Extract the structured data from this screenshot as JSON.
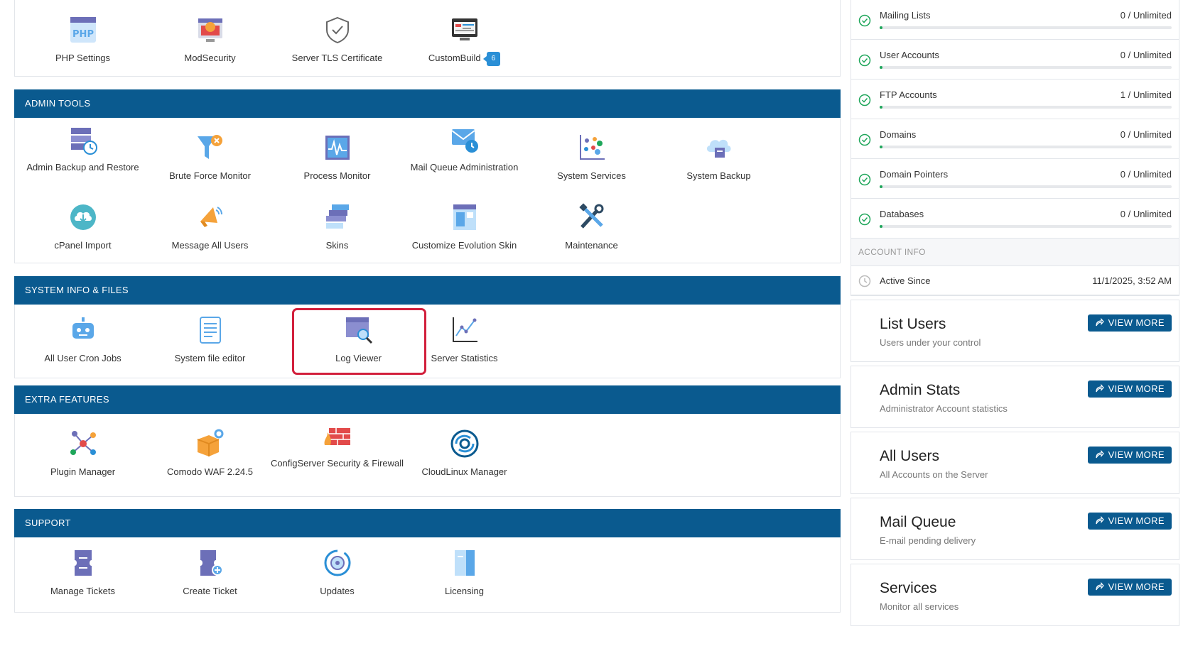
{
  "top_tiles": [
    {
      "label": "PHP Settings",
      "icon": "php-icon"
    },
    {
      "label": "ModSecurity",
      "icon": "modsecurity-icon"
    },
    {
      "label": "Server TLS Certificate",
      "icon": "shield-check-icon"
    },
    {
      "label": "CustomBuild",
      "icon": "custombuild-icon",
      "badge": "6"
    }
  ],
  "sections": {
    "admin_tools": {
      "title": "ADMIN TOOLS",
      "tiles": [
        {
          "label": "Admin Backup and Restore"
        },
        {
          "label": "Brute Force Monitor"
        },
        {
          "label": "Process Monitor"
        },
        {
          "label": "Mail Queue Administration"
        },
        {
          "label": "System Services"
        },
        {
          "label": "System Backup"
        },
        {
          "label": "cPanel Import"
        },
        {
          "label": "Message All Users"
        },
        {
          "label": "Skins"
        },
        {
          "label": "Customize Evolution Skin"
        },
        {
          "label": "Maintenance"
        }
      ]
    },
    "system_info": {
      "title": "SYSTEM INFO & FILES",
      "tiles": [
        {
          "label": "All User Cron Jobs"
        },
        {
          "label": "System file editor"
        },
        {
          "label": "Log Viewer"
        },
        {
          "label": "Server Statistics"
        }
      ]
    },
    "extra_features": {
      "title": "EXTRA FEATURES",
      "tiles": [
        {
          "label": "Plugin Manager"
        },
        {
          "label": "Comodo WAF 2.24.5"
        },
        {
          "label": "ConfigServer Security & Firewall"
        },
        {
          "label": "CloudLinux Manager"
        }
      ]
    },
    "support": {
      "title": "SUPPORT",
      "tiles": [
        {
          "label": "Manage Tickets"
        },
        {
          "label": "Create Ticket"
        },
        {
          "label": "Updates"
        },
        {
          "label": "Licensing"
        }
      ]
    }
  },
  "usage": [
    {
      "name": "Mailing Lists",
      "value": "0 / Unlimited"
    },
    {
      "name": "User Accounts",
      "value": "0 / Unlimited"
    },
    {
      "name": "FTP Accounts",
      "value": "1 / Unlimited"
    },
    {
      "name": "Domains",
      "value": "0 / Unlimited"
    },
    {
      "name": "Domain Pointers",
      "value": "0 / Unlimited"
    },
    {
      "name": "Databases",
      "value": "0 / Unlimited"
    }
  ],
  "account_info": {
    "header": "ACCOUNT INFO",
    "active_since_label": "Active Since",
    "active_since_value": "11/1/2025, 3:52 AM"
  },
  "cards": [
    {
      "title": "List Users",
      "subtitle": "Users under your control",
      "button": "VIEW MORE"
    },
    {
      "title": "Admin Stats",
      "subtitle": "Administrator Account statistics",
      "button": "VIEW MORE"
    },
    {
      "title": "All Users",
      "subtitle": "All Accounts on the Server",
      "button": "VIEW MORE"
    },
    {
      "title": "Mail Queue",
      "subtitle": "E-mail pending delivery",
      "button": "VIEW MORE"
    },
    {
      "title": "Services",
      "subtitle": "Monitor all services",
      "button": "VIEW MORE"
    }
  ],
  "colors": {
    "header_blue": "#0a5a8f",
    "highlight_red": "#d21f3c",
    "ok_green": "#1ea65a",
    "badge_blue": "#2a8fd6"
  }
}
